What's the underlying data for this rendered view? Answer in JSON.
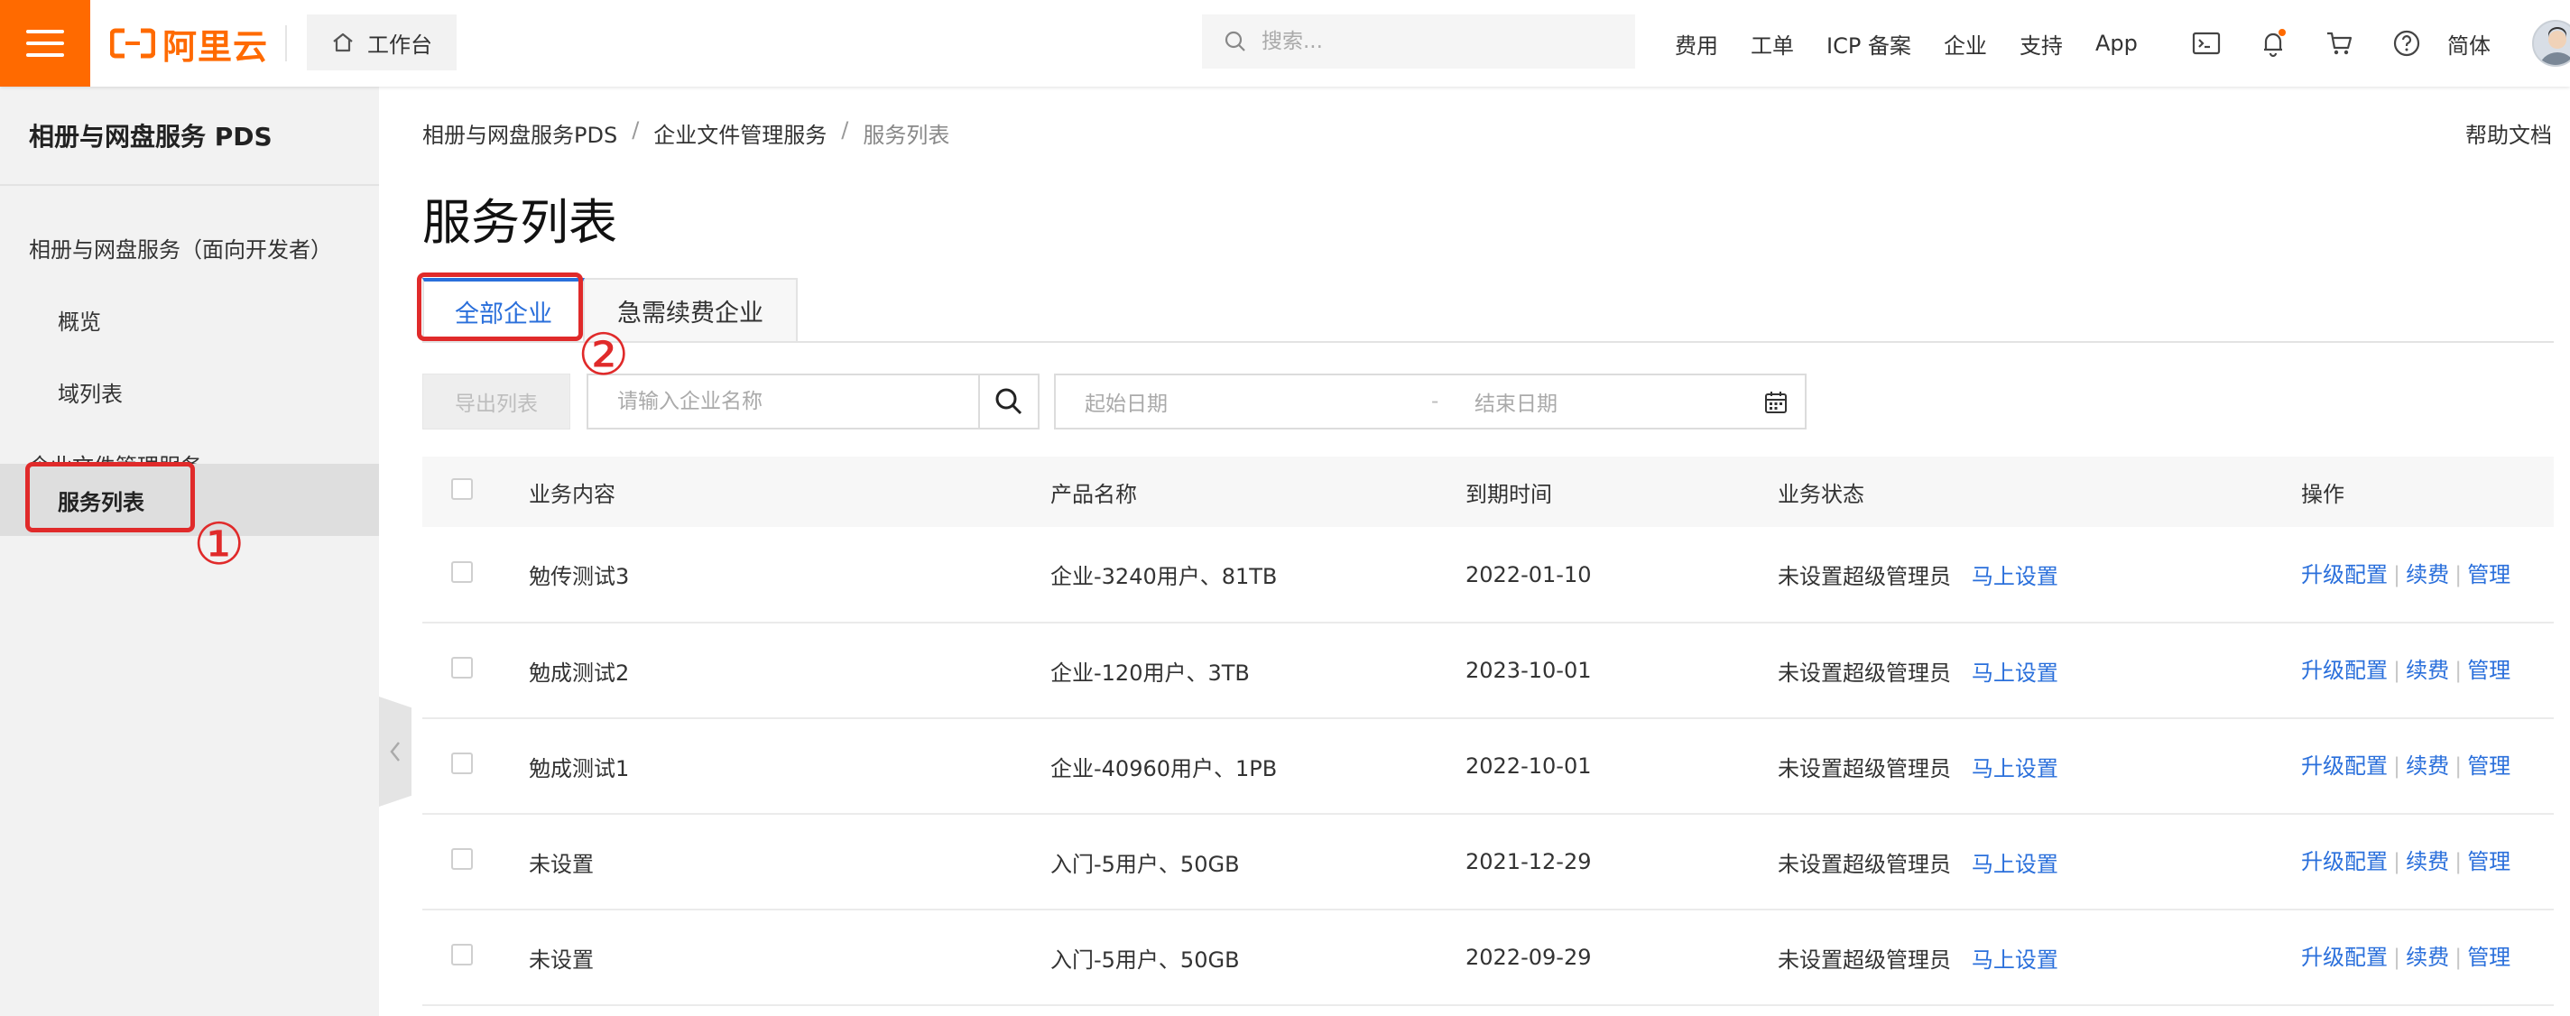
{
  "topbar": {
    "logo_text": "阿里云",
    "workbench_label": "工作台",
    "search_placeholder": "搜索...",
    "nav": [
      "费用",
      "工单",
      "ICP 备案",
      "企业",
      "支持",
      "App"
    ],
    "lang": "简体",
    "accent": "#ff6a00"
  },
  "sidebar": {
    "title": "相册与网盘服务 PDS",
    "items": [
      {
        "label": "相册与网盘服务（面向开发者）"
      },
      {
        "label": "概览"
      },
      {
        "label": "域列表"
      },
      {
        "label": "企业文件管理服务"
      },
      {
        "label": "服务列表"
      }
    ]
  },
  "breadcrumb": [
    "相册与网盘服务PDS",
    "企业文件管理服务",
    "服务列表"
  ],
  "help_label": "帮助文档",
  "page_title": "服务列表",
  "tabs": [
    {
      "label": "全部企业"
    },
    {
      "label": "急需续费企业"
    }
  ],
  "annotations": [
    "①",
    "②"
  ],
  "toolbar": {
    "export_label": "导出列表",
    "name_placeholder": "请输入企业名称",
    "start_date_placeholder": "起始日期",
    "date_separator": "-",
    "end_date_placeholder": "结束日期"
  },
  "table": {
    "headers": [
      "业务内容",
      "产品名称",
      "到期时间",
      "业务状态",
      "操作"
    ],
    "rows": [
      {
        "business": "勉传测试3",
        "product": "企业-3240用户、81TB",
        "expire": "2022-01-10",
        "status": "未设置超级管理员",
        "status_link": "马上设置"
      },
      {
        "business": "勉成测试2",
        "product": "企业-120用户、3TB",
        "expire": "2023-10-01",
        "status": "未设置超级管理员",
        "status_link": "马上设置"
      },
      {
        "business": "勉成测试1",
        "product": "企业-40960用户、1PB",
        "expire": "2022-10-01",
        "status": "未设置超级管理员",
        "status_link": "马上设置"
      },
      {
        "business": "未设置",
        "product": "入门-5用户、50GB",
        "expire": "2021-12-29",
        "status": "未设置超级管理员",
        "status_link": "马上设置"
      },
      {
        "business": "未设置",
        "product": "入门-5用户、50GB",
        "expire": "2022-09-29",
        "status": "未设置超级管理员",
        "status_link": "马上设置"
      }
    ],
    "ops": {
      "upgrade": "升级配置",
      "renew": "续费",
      "manage": "管理"
    }
  },
  "colors": {
    "link": "#2a6fdb",
    "annotation": "#e02a2a"
  }
}
